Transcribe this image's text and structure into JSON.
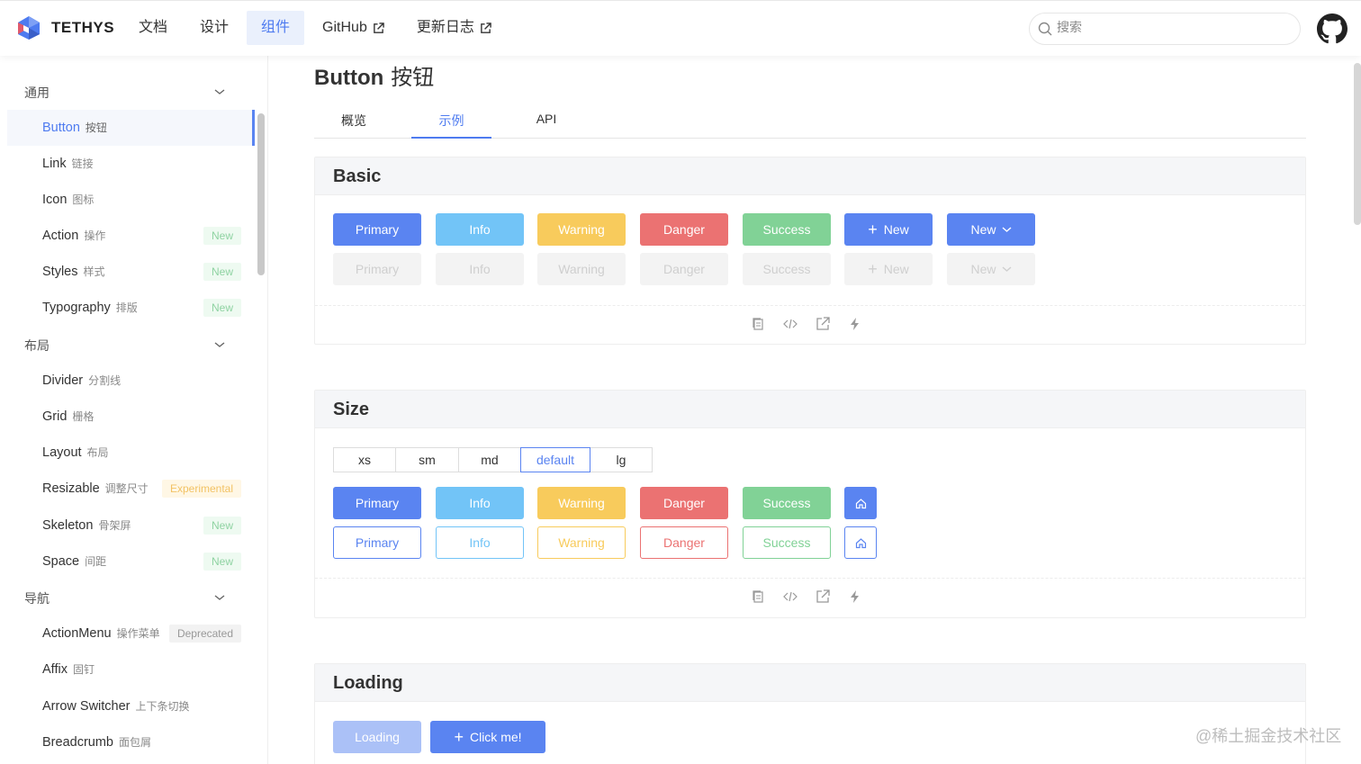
{
  "header": {
    "logo_text": "TETHYS",
    "nav": [
      {
        "label": "文档",
        "active": false,
        "external": false
      },
      {
        "label": "设计",
        "active": false,
        "external": false
      },
      {
        "label": "组件",
        "active": true,
        "external": false
      },
      {
        "label": "GitHub",
        "active": false,
        "external": true
      },
      {
        "label": "更新日志",
        "active": false,
        "external": true
      }
    ],
    "search_placeholder": "搜索"
  },
  "sidebar": {
    "groups": {
      "general": "通用",
      "layout": "布局",
      "nav": "导航"
    },
    "items": [
      {
        "en": "Button",
        "cn": "按钮",
        "badge": ""
      },
      {
        "en": "Link",
        "cn": "链接",
        "badge": ""
      },
      {
        "en": "Icon",
        "cn": "图标",
        "badge": ""
      },
      {
        "en": "Action",
        "cn": "操作",
        "badge": "New"
      },
      {
        "en": "Styles",
        "cn": "样式",
        "badge": "New"
      },
      {
        "en": "Typography",
        "cn": "排版",
        "badge": "New"
      },
      {
        "en": "Divider",
        "cn": "分割线",
        "badge": ""
      },
      {
        "en": "Grid",
        "cn": "栅格",
        "badge": ""
      },
      {
        "en": "Layout",
        "cn": "布局",
        "badge": ""
      },
      {
        "en": "Resizable",
        "cn": "调整尺寸",
        "badge": "Experimental"
      },
      {
        "en": "Skeleton",
        "cn": "骨架屏",
        "badge": "New"
      },
      {
        "en": "Space",
        "cn": "间距",
        "badge": "New"
      },
      {
        "en": "ActionMenu",
        "cn": "操作菜单",
        "badge": "Deprecated"
      },
      {
        "en": "Affix",
        "cn": "固钉",
        "badge": ""
      },
      {
        "en": "Arrow Switcher",
        "cn": "上下条切换",
        "badge": ""
      },
      {
        "en": "Breadcrumb",
        "cn": "面包屑",
        "badge": ""
      }
    ]
  },
  "page": {
    "title_en": "Button",
    "title_cn": "按钮",
    "tabs": [
      "概览",
      "示例",
      "API"
    ],
    "active_tab": "示例"
  },
  "basic": {
    "title": "Basic",
    "buttons": [
      "Primary",
      "Info",
      "Warning",
      "Danger",
      "Success",
      "New",
      "New"
    ],
    "disabled_buttons": [
      "Primary",
      "Info",
      "Warning",
      "Danger",
      "Success",
      "New",
      "New"
    ]
  },
  "size": {
    "title": "Size",
    "sizes": [
      "xs",
      "sm",
      "md",
      "default",
      "lg"
    ],
    "selected_size": "default",
    "buttons": [
      "Primary",
      "Info",
      "Warning",
      "Danger",
      "Success"
    ],
    "outline_buttons": [
      "Primary",
      "Info",
      "Warning",
      "Danger",
      "Success"
    ]
  },
  "loading": {
    "title": "Loading",
    "loading_button": "Loading",
    "click_button": "Click me!"
  },
  "watermark": "@稀土掘金技术社区",
  "colors": {
    "primary": "#5a84f1",
    "info": "#72c4f7",
    "warning": "#f8cb5c",
    "danger": "#eb7272",
    "success": "#81d296"
  }
}
